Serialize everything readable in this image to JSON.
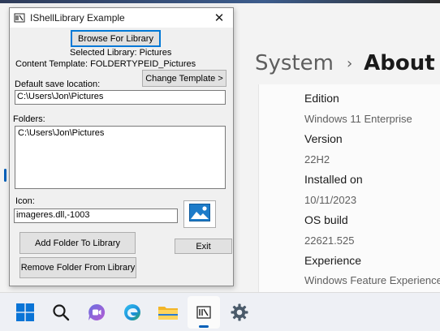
{
  "dialog": {
    "title": "IShellLibrary Example",
    "close_glyph": "✕",
    "browse_button": "Browse For Library",
    "selected_library": "Selected Library: Pictures",
    "content_template": "Content Template: FOLDERTYPEID_Pictures",
    "change_template_button": "Change Template >",
    "default_save_label": "Default save location:",
    "default_save_value": "C:\\Users\\Jon\\Pictures",
    "folders_label": "Folders:",
    "folders": [
      "C:\\Users\\Jon\\Pictures"
    ],
    "icon_label": "Icon:",
    "icon_value": "imageres.dll,-1003",
    "add_folder_button": "Add Folder To Library",
    "remove_folder_button": "Remove Folder From Library",
    "exit_button": "Exit"
  },
  "settings": {
    "breadcrumb_parent": "System",
    "breadcrumb_separator": "›",
    "breadcrumb_current": "About",
    "specs": [
      {
        "label": "Edition",
        "value": "Windows 11 Enterprise"
      },
      {
        "label": "Version",
        "value": "22H2"
      },
      {
        "label": "Installed on",
        "value": "10/11/2023"
      },
      {
        "label": "OS build",
        "value": "22621.525"
      },
      {
        "label": "Experience",
        "value": "Windows Feature Experience"
      }
    ]
  },
  "taskbar": {
    "items": [
      {
        "icon": "windows-start-icon",
        "active": false
      },
      {
        "icon": "search-icon",
        "active": false
      },
      {
        "icon": "teams-chat-icon",
        "active": false
      },
      {
        "icon": "edge-browser-icon",
        "active": false
      },
      {
        "icon": "file-explorer-icon",
        "active": false
      },
      {
        "icon": "shell-library-app-icon",
        "active": true
      },
      {
        "icon": "settings-gear-icon",
        "active": false
      }
    ]
  },
  "colors": {
    "accent": "#005fb8",
    "focus_border": "#0078d7",
    "dialog_bg": "#f0f0f0"
  }
}
